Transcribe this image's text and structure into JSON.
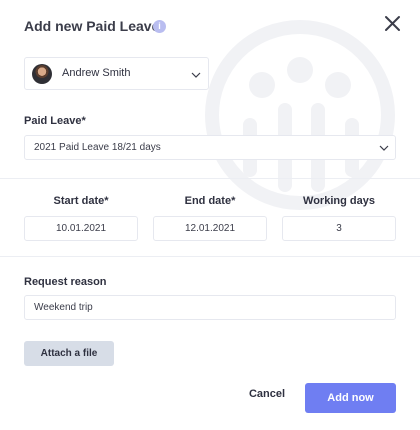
{
  "dialog": {
    "title": "Add new Paid Leave",
    "info_icon": "info-icon",
    "close_icon": "close-icon"
  },
  "employee": {
    "name": "Andrew Smith",
    "avatar": "avatar"
  },
  "paid_leave": {
    "label": "Paid Leave*",
    "selected": "2021 Paid Leave 18/21 days"
  },
  "dates": {
    "start_label": "Start date*",
    "start_value": "10.01.2021",
    "end_label": "End date*",
    "end_value": "12.01.2021",
    "working_days_label": "Working days",
    "working_days_value": "3"
  },
  "reason": {
    "label": "Request reason",
    "value": "Weekend trip"
  },
  "actions": {
    "attach": "Attach a file",
    "cancel": "Cancel",
    "submit": "Add now"
  },
  "colors": {
    "accent": "#6f7ef2",
    "attach_bg": "#d7dde7",
    "border": "#e6e8ef",
    "watermark": "#f2f3f6"
  }
}
